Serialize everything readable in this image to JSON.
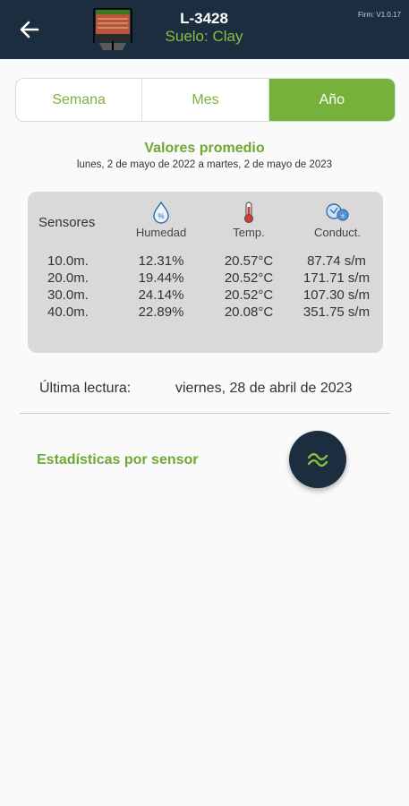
{
  "header": {
    "device_id": "L-3428",
    "soil": "Suelo: Clay",
    "firmware": "Firm: V1.0.17",
    "back_icon": "arrow-left-icon",
    "logo_icon": "soil-sensor-logo"
  },
  "tabs": [
    {
      "label": "Semana",
      "active": false
    },
    {
      "label": "Mes",
      "active": false
    },
    {
      "label": "Año",
      "active": true
    }
  ],
  "averages": {
    "title": "Valores promedio",
    "range": "lunes, 2 de mayo de 2022 a martes, 2 de mayo de 2023",
    "sensors_label": "Sensores",
    "columns": [
      {
        "label": "Humedad",
        "icon": "water-drop-icon"
      },
      {
        "label": "Temp.",
        "icon": "thermometer-icon"
      },
      {
        "label": "Conduct.",
        "icon": "conductivity-icon"
      }
    ],
    "rows": [
      {
        "sensor": "10.0m.",
        "humidity": "12.31%",
        "temp": "20.57°C",
        "conduct": "87.74 s/m"
      },
      {
        "sensor": "20.0m.",
        "humidity": "19.44%",
        "temp": "20.52°C",
        "conduct": "171.71 s/m"
      },
      {
        "sensor": "30.0m.",
        "humidity": "24.14%",
        "temp": "20.52°C",
        "conduct": "107.30 s/m"
      },
      {
        "sensor": "40.0m.",
        "humidity": "22.89%",
        "temp": "20.08°C",
        "conduct": "351.75 s/m"
      }
    ]
  },
  "last_reading": {
    "label": "Última lectura:",
    "value": "viernes, 28 de abril de 2023"
  },
  "stats": {
    "label": "Estadísticas por sensor",
    "fab_icon": "stats-wave-icon"
  },
  "colors": {
    "appbar": "#1c2d40",
    "accent_green": "#76b13c",
    "card_bg": "#d9d9d9"
  }
}
